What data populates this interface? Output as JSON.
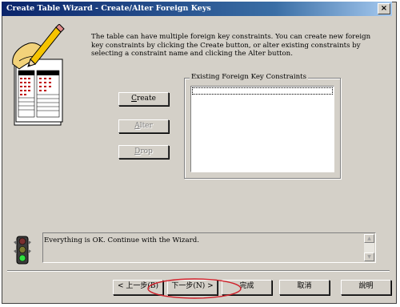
{
  "window": {
    "title": "Create Table Wizard - Create/Alter Foreign Keys",
    "close_label": "×"
  },
  "description": "The table can have multiple foreign key constraints. You can create new foreign key constraints by clicking the Create button, or alter existing constraints by selecting a constraint name and clicking the Alter button.",
  "actions": {
    "create": {
      "hotkey": "C",
      "rest": "reate"
    },
    "alter": {
      "hotkey": "A",
      "rest": "lter"
    },
    "drop": {
      "hotkey": "D",
      "rest": "rop"
    }
  },
  "constraints_group": {
    "label": "Existing Foreign Key Constraints",
    "items": []
  },
  "status": {
    "message": "Everything is OK.  Continue with the Wizard.",
    "icon": "traffic-light-icon"
  },
  "nav": {
    "back": "< 上一步(B)",
    "next": "下一步(N) >",
    "finish": "完成",
    "cancel": "取消",
    "help": "說明"
  },
  "highlight_color": "#d0202a"
}
